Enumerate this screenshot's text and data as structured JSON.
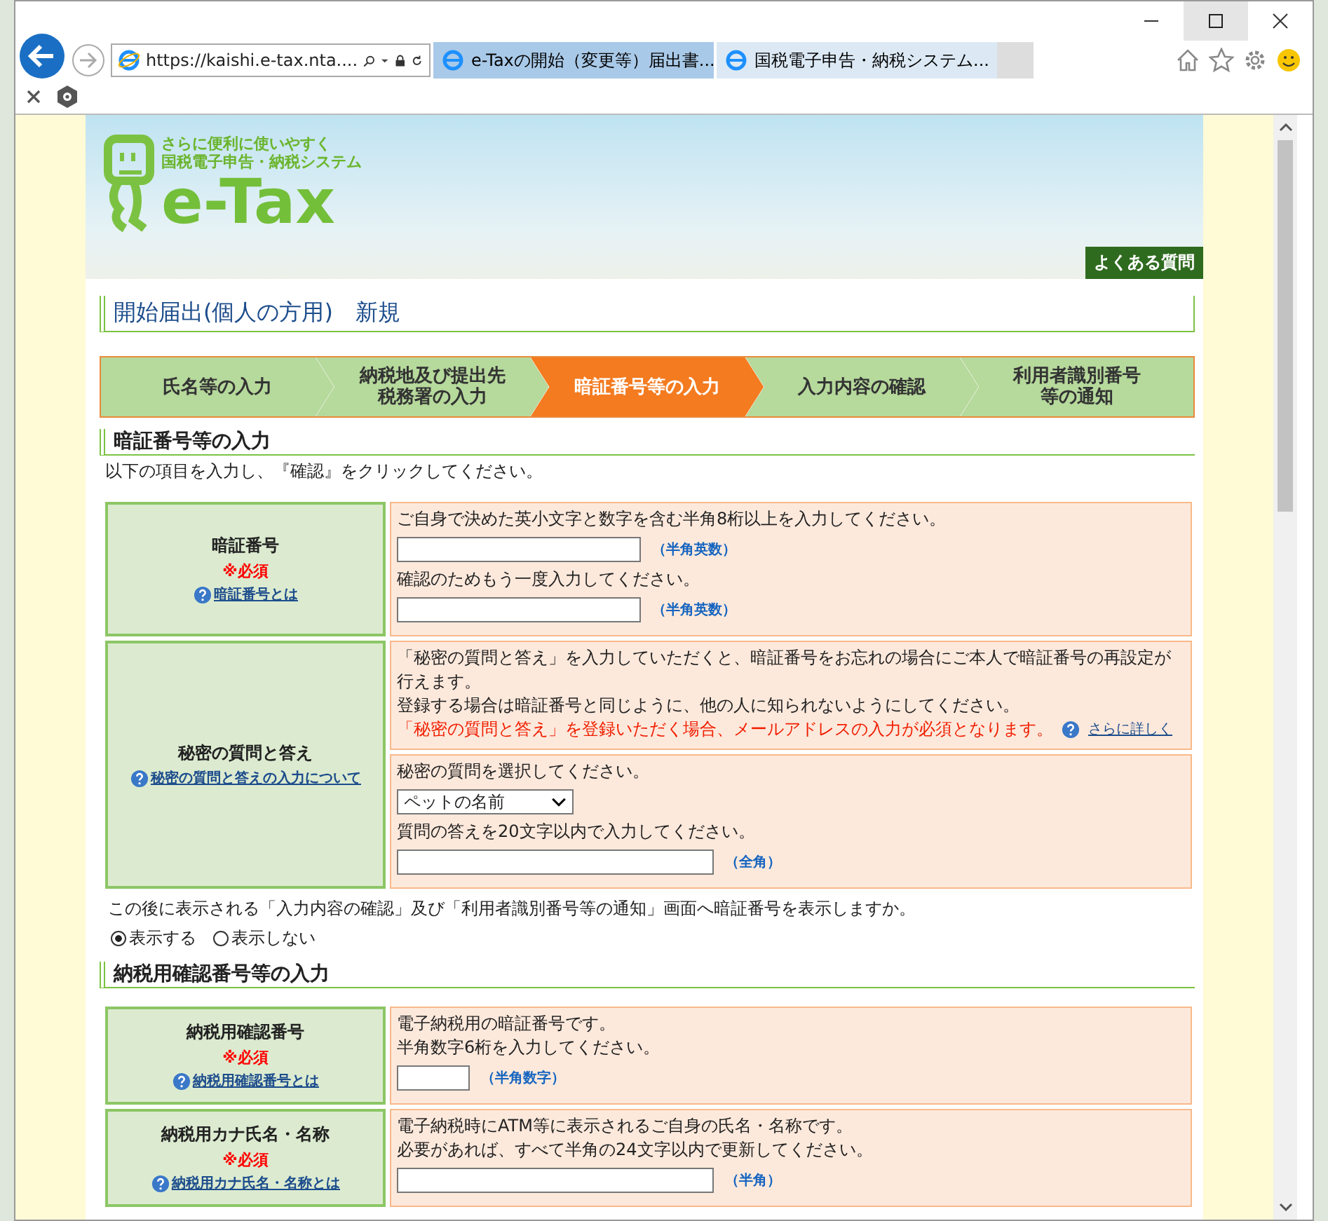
{
  "browser": {
    "address": "https://kaishi.e-tax.nta....",
    "tabs": [
      {
        "title": "e-Taxの開始（変更等）届出書...",
        "selected": false
      },
      {
        "title": "国税電子申告・納税システム...",
        "selected": true
      }
    ]
  },
  "header": {
    "tagline": [
      "さらに便利に使いやすく",
      "国税電子申告・納税システム"
    ],
    "logo_text": "e-Tax",
    "faq": "よくある質問"
  },
  "page_title": "開始届出(個人の方用)　新規",
  "steps": [
    {
      "lines": [
        "氏名等の入力"
      ],
      "selected": false
    },
    {
      "lines": [
        "納税地及び提出先",
        "税務署の入力"
      ],
      "selected": false
    },
    {
      "lines": [
        "暗証番号等の入力"
      ],
      "selected": true
    },
    {
      "lines": [
        "入力内容の確認"
      ],
      "selected": false
    },
    {
      "lines": [
        "利用者識別番号",
        "等の通知"
      ],
      "selected": false
    }
  ],
  "sections": [
    {
      "title": "暗証番号等の入力",
      "intro": "以下の項目を入力し、『確認』をクリックしてください。",
      "rows": [
        {
          "label": "暗証番号",
          "required": "※必須",
          "help": "暗証番号とは",
          "cells": [
            [
              {
                "kind": "text",
                "text": "ご自身で決めた英小文字と数字を含む半角8桁以上を入力してください。"
              },
              {
                "kind": "input",
                "hint": "（半角英数）"
              },
              {
                "kind": "text",
                "text": "確認のためもう一度入力してください。"
              },
              {
                "kind": "input",
                "hint": "（半角英数）"
              }
            ]
          ]
        },
        {
          "label": "秘密の質問と答え",
          "help": "秘密の質問と答えの入力について",
          "cells": [
            [
              {
                "kind": "text",
                "text": "「秘密の質問と答え」を入力していただくと、暗証番号をお忘れの場合にご本人で暗証番号の再設定が行えます。"
              },
              {
                "kind": "text",
                "text": "登録する場合は暗証番号と同じように、他の人に知られないようにしてください。"
              },
              {
                "kind": "warning",
                "text": "「秘密の質問と答え」を登録いただく場合、メールアドレスの入力が必須となります。",
                "link": "さらに詳しく"
              }
            ],
            [
              {
                "kind": "text",
                "text": "秘密の質問を選択してください。"
              },
              {
                "kind": "select",
                "value": "ペットの名前"
              },
              {
                "kind": "text",
                "text": "質問の答えを20文字以内で入力してください。"
              },
              {
                "kind": "input",
                "hint": "（全角）"
              }
            ]
          ]
        }
      ],
      "after": {
        "question": "この後に表示される「入力内容の確認」及び「利用者識別番号等の通知」画面へ暗証番号を表示しますか。",
        "options": [
          {
            "label": "表示する",
            "selected": true
          },
          {
            "label": "表示しない",
            "selected": false
          }
        ]
      }
    },
    {
      "title": "納税用確認番号等の入力",
      "rows": [
        {
          "label": "納税用確認番号",
          "required": "※必須",
          "help": "納税用確認番号とは",
          "cells": [
            [
              {
                "kind": "text",
                "text": "電子納税用の暗証番号です。"
              },
              {
                "kind": "text",
                "text": "半角数字6桁を入力してください。"
              },
              {
                "kind": "input",
                "hint": "（半角数字）"
              }
            ]
          ]
        },
        {
          "label": "納税用カナ氏名・名称",
          "required": "※必須",
          "help": "納税用カナ氏名・名称とは",
          "cells": [
            [
              {
                "kind": "text",
                "text": "電子納税時にATM等に表示されるご自身の氏名・名称です。"
              },
              {
                "kind": "text",
                "text": "必要があれば、すべて半角の24文字以内で更新してください。"
              },
              {
                "kind": "input",
                "hint": "（半角）"
              }
            ]
          ]
        }
      ]
    }
  ]
}
